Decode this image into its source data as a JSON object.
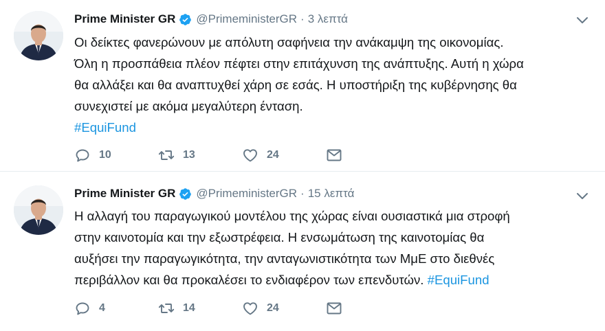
{
  "tweets": [
    {
      "author_name": "Prime Minister GR",
      "handle": "@PrimeministerGR",
      "separator": "·",
      "time": "3 λεπτά",
      "text_lines": [
        "Οι δείκτες φανερώνουν με απόλυτη σαφήνεια την ανάκαμψη της οικονομίας.",
        "Όλη η προσπάθεια πλέον πέφτει στην επιτάχυνση της ανάπτυξης. Αυτή η χώρα",
        "θα αλλάξει και θα αναπτυχθεί χάρη σε εσάς. Η υποστήριξη της κυβέρνησης θα",
        "συνεχιστεί με ακόμα μεγαλύτερη ένταση."
      ],
      "hashtag": "#EquiFund",
      "replies": "10",
      "retweets": "13",
      "likes": "24"
    },
    {
      "author_name": "Prime Minister GR",
      "handle": "@PrimeministerGR",
      "separator": "·",
      "time": "15 λεπτά",
      "text_lines": [
        "Η αλλαγή του παραγωγικού μοντέλου της χώρας είναι ουσιαστικά μια στροφή",
        "στην καινοτομία και την εξωστρέφεια. Η ενσωμάτωση της καινοτομίας θα",
        "αυξήσει την παραγωγικότητα, την ανταγωνιστικότητα των ΜμΕ στο διεθνές"
      ],
      "last_line_text": "περιβάλλον και θα προκαλέσει το ενδιαφέρον των επενδυτών. ",
      "hashtag": "#EquiFund",
      "replies": "4",
      "retweets": "14",
      "likes": "24"
    }
  ],
  "icons": {
    "verified": "verified-badge-icon",
    "more": "chevron-down-icon",
    "reply": "reply-icon",
    "retweet": "retweet-icon",
    "like": "heart-icon",
    "dm": "envelope-icon"
  },
  "colors": {
    "text": "#14171a",
    "secondary": "#657786",
    "hashtag": "#1b95e0",
    "verified": "#1da1f2",
    "divider": "#e6ecf0"
  }
}
